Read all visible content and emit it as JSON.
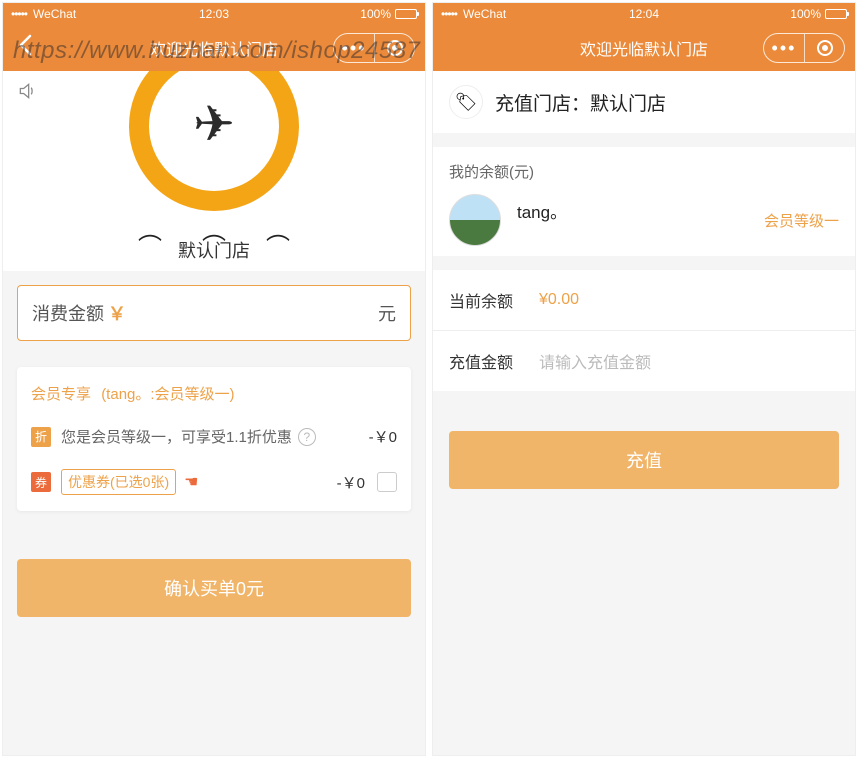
{
  "watermark": "https://www.huzhan.com/ishop24587",
  "status": {
    "carrier": "WeChat",
    "battery_pct": "100%"
  },
  "left": {
    "status_time": "12:03",
    "nav_title": "欢迎光临默认门店",
    "shop_name": "默认门店",
    "consume_label": "消费金额",
    "currency": "￥",
    "unit": "元",
    "member_a": "会员专享",
    "member_b": "(tang。:会员等级一)",
    "discount_tag": "折",
    "discount_text": "您是会员等级一，可享受1.1折优惠",
    "discount_amount": "-￥0",
    "coupon_tag": "券",
    "coupon_pill": "优惠券(已选0张)",
    "coupon_amount": "-￥0",
    "confirm": "确认买单0元"
  },
  "right": {
    "status_time": "12:04",
    "nav_title": "欢迎光临默认门店",
    "store_label": "充值门店：默认门店",
    "balance_label": "我的余额(元)",
    "username": "tang。",
    "tier": "会员等级一",
    "current_balance_k": "当前余额",
    "current_balance_v": "¥0.00",
    "recharge_amount_k": "充值金额",
    "recharge_placeholder": "请输入充值金额",
    "recharge_btn": "充值"
  }
}
